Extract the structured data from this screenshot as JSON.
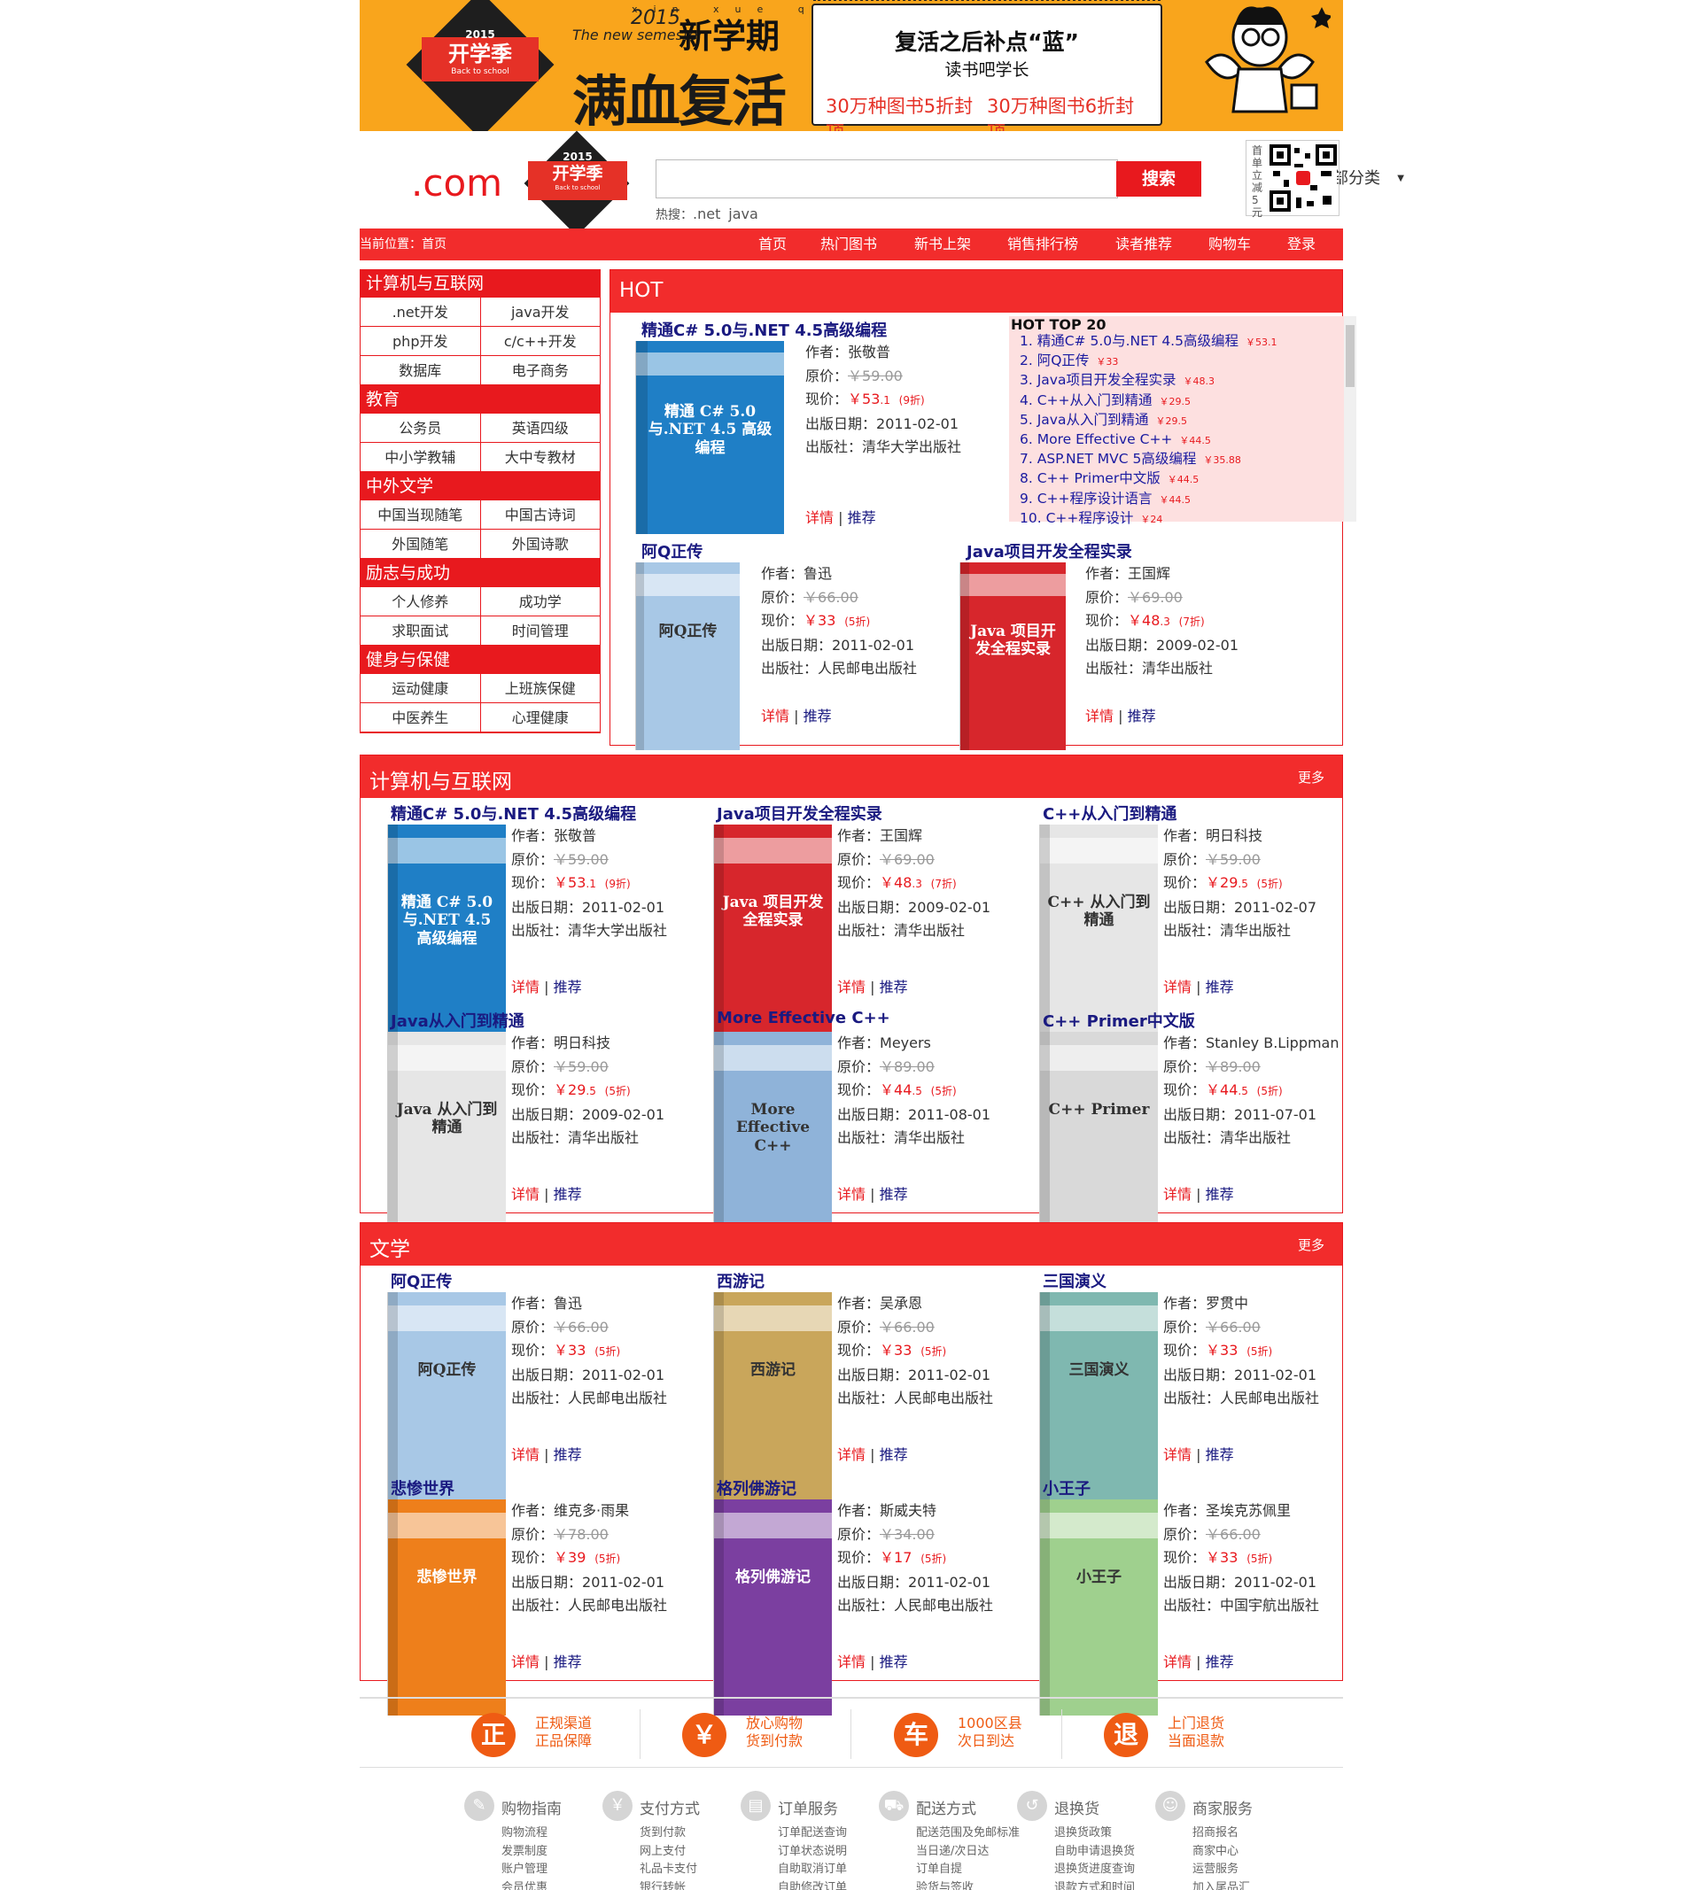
{
  "banner": {
    "badge_year": "2015",
    "badge_main": "开学季",
    "badge_sub": "Back to school",
    "pinyin": "xin xue qi",
    "year2": "2015",
    "semester_en": "The new semester",
    "semester_cn": "新学期",
    "slogan": "满血复活",
    "headline": "复活之后补点“蓝”",
    "subhead": "读书吧学长",
    "offer1": "30万种图书5折封顶",
    "offer2": "30万种图书6折封顶"
  },
  "header": {
    "logo_domain": ".com",
    "logo_badge_year": "2015",
    "logo_badge_main": "开学季",
    "logo_badge_sub": "Back to school",
    "search_placeholder": "",
    "category_select": "全部分类",
    "search_button": "搜索",
    "hot_prefix": "热搜：",
    "hot_terms": [
      ".net",
      "java"
    ],
    "qr_caption": "首单立减5元"
  },
  "nav": {
    "breadcrumb": "当前位置：首页",
    "items": [
      "首页",
      "热门图书",
      "新书上架",
      "销售排行榜",
      "读者推荐",
      "购物车",
      "登录"
    ]
  },
  "sidebar": [
    {
      "title": "计算机与互联网",
      "items": [
        ".net开发",
        "java开发",
        "php开发",
        "c/c++开发",
        "数据库",
        "电子商务"
      ]
    },
    {
      "title": "教育",
      "items": [
        "公务员",
        "英语四级",
        "中小学教辅",
        "大中专教材"
      ]
    },
    {
      "title": "中外文学",
      "items": [
        "中国当现随笔",
        "中国古诗词",
        "外国随笔",
        "外国诗歌"
      ]
    },
    {
      "title": "励志与成功",
      "items": [
        "个人修养",
        "成功学",
        "求职面试",
        "时间管理"
      ]
    },
    {
      "title": "健身与保健",
      "items": [
        "运动健康",
        "上班族保健",
        "中医养生",
        "心理健康"
      ]
    }
  ],
  "labels": {
    "author": "作者：",
    "orig_price": "原价：",
    "cur_price": "现价：",
    "pub_date": "出版日期：",
    "publisher": "出版社：",
    "detail": "详情",
    "sep": "|",
    "recommend": "推荐",
    "yen": "￥",
    "more": "更多"
  },
  "hot": {
    "title": "HOT",
    "books": [
      {
        "title": "精通C# 5.0与.NET 4.5高级编程",
        "author": "张敬普",
        "orig": "￥59.00",
        "cur_int": "￥53",
        "cur_dec": ".1",
        "discount": "(9折)",
        "date": "2011-02-01",
        "publisher": "清华大学出版社",
        "cover_color": "#1f7fc6",
        "cover_text": "精通 C# 5.0与.NET 4.5 高级编程"
      },
      {
        "title": "阿Q正传",
        "author": "鲁迅",
        "orig": "￥66.00",
        "cur_int": "￥33",
        "cur_dec": "",
        "discount": "(5折)",
        "date": "2011-02-01",
        "publisher": "人民邮电出版社",
        "cover_color": "#a8c8e6",
        "cover_text": "阿Q正传"
      },
      {
        "title": "Java项目开发全程实录",
        "author": "王国辉",
        "orig": "￥69.00",
        "cur_int": "￥48",
        "cur_dec": ".3",
        "discount": "(7折)",
        "date": "2009-02-01",
        "publisher": "清华出版社",
        "cover_color": "#d7262c",
        "cover_text": "Java 项目开发全程实录"
      }
    ],
    "top20": {
      "title": "HOT TOP 20",
      "items": [
        {
          "rank": "1.",
          "name": "精通C# 5.0与.NET 4.5高级编程",
          "price": "￥53.1"
        },
        {
          "rank": "2.",
          "name": "阿Q正传",
          "price": "￥33"
        },
        {
          "rank": "3.",
          "name": "Java项目开发全程实录",
          "price": "￥48.3"
        },
        {
          "rank": "4.",
          "name": "C++从入门到精通",
          "price": "￥29.5"
        },
        {
          "rank": "5.",
          "name": "Java从入门到精通",
          "price": "￥29.5"
        },
        {
          "rank": "6.",
          "name": "More Effective C++",
          "price": "￥44.5"
        },
        {
          "rank": "7.",
          "name": "ASP.NET MVC 5高级编程",
          "price": "￥35.88"
        },
        {
          "rank": "8.",
          "name": "C++ Primer中文版",
          "price": "￥44.5"
        },
        {
          "rank": "9.",
          "name": "C++程序设计语言",
          "price": "￥44.5"
        },
        {
          "rank": "10.",
          "name": "C++程序设计",
          "price": "￥24"
        }
      ]
    }
  },
  "sections": [
    {
      "title": "计算机与互联网",
      "books": [
        {
          "title": "精通C# 5.0与.NET 4.5高级编程",
          "author": "张敬普",
          "orig": "￥59.00",
          "cur_int": "￥53",
          "cur_dec": ".1",
          "discount": "(9折)",
          "date": "2011-02-01",
          "publisher": "清华大学出版社",
          "cover_color": "#1f7fc6",
          "cover_text": "精通 C# 5.0与.NET 4.5 高级编程"
        },
        {
          "title": "Java项目开发全程实录",
          "author": "王国辉",
          "orig": "￥69.00",
          "cur_int": "￥48",
          "cur_dec": ".3",
          "discount": "(7折)",
          "date": "2009-02-01",
          "publisher": "清华出版社",
          "cover_color": "#d7262c",
          "cover_text": "Java 项目开发全程实录"
        },
        {
          "title": "C++从入门到精通",
          "author": "明日科技",
          "orig": "￥59.00",
          "cur_int": "￥29",
          "cur_dec": ".5",
          "discount": "(5折)",
          "date": "2011-02-07",
          "publisher": "清华出版社",
          "cover_color": "#e6e6e6",
          "cover_text": "C++ 从入门到精通"
        },
        {
          "title": "Java从入门到精通",
          "author": "明日科技",
          "orig": "￥59.00",
          "cur_int": "￥29",
          "cur_dec": ".5",
          "discount": "(5折)",
          "date": "2009-02-01",
          "publisher": "清华出版社",
          "cover_color": "#e6e6e6",
          "cover_text": "Java 从入门到精通"
        },
        {
          "title": "More Effective C++",
          "author": "Meyers",
          "orig": "￥89.00",
          "cur_int": "￥44",
          "cur_dec": ".5",
          "discount": "(5折)",
          "date": "2011-08-01",
          "publisher": "清华出版社",
          "cover_color": "#8fb3d9",
          "cover_text": "More Effective C++"
        },
        {
          "title": "C++ Primer中文版",
          "author": "Stanley B.Lippman",
          "orig": "￥89.00",
          "cur_int": "￥44",
          "cur_dec": ".5",
          "discount": "(5折)",
          "date": "2011-07-01",
          "publisher": "清华出版社",
          "cover_color": "#d9d9d9",
          "cover_text": "C++ Primer"
        }
      ]
    },
    {
      "title": "文学",
      "books": [
        {
          "title": "阿Q正传",
          "author": "鲁迅",
          "orig": "￥66.00",
          "cur_int": "￥33",
          "cur_dec": "",
          "discount": "(5折)",
          "date": "2011-02-01",
          "publisher": "人民邮电出版社",
          "cover_color": "#a8c8e6",
          "cover_text": "阿Q正传"
        },
        {
          "title": "西游记",
          "author": "吴承恩",
          "orig": "￥66.00",
          "cur_int": "￥33",
          "cur_dec": "",
          "discount": "(5折)",
          "date": "2011-02-01",
          "publisher": "人民邮电出版社",
          "cover_color": "#c9a65b",
          "cover_text": "西游记"
        },
        {
          "title": "三国演义",
          "author": "罗贯中",
          "orig": "￥66.00",
          "cur_int": "￥33",
          "cur_dec": "",
          "discount": "(5折)",
          "date": "2011-02-01",
          "publisher": "人民邮电出版社",
          "cover_color": "#7fb8b0",
          "cover_text": "三国演义"
        },
        {
          "title": "悲惨世界",
          "author": "维克多·雨果",
          "orig": "￥78.00",
          "cur_int": "￥39",
          "cur_dec": "",
          "discount": "(5折)",
          "date": "2011-02-01",
          "publisher": "人民邮电出版社",
          "cover_color": "#ee7f1b",
          "cover_text": "悲惨世界"
        },
        {
          "title": "格列佛游记",
          "author": "斯威夫特",
          "orig": "￥34.00",
          "cur_int": "￥17",
          "cur_dec": "",
          "discount": "(5折)",
          "date": "2011-02-01",
          "publisher": "人民邮电出版社",
          "cover_color": "#7b3fa0",
          "cover_text": "格列佛游记"
        },
        {
          "title": "小王子",
          "author": "圣埃克苏佩里",
          "orig": "￥66.00",
          "cur_int": "￥33",
          "cur_dec": "",
          "discount": "(5折)",
          "date": "2011-02-01",
          "publisher": "中国宇航出版社",
          "cover_color": "#9fd08e",
          "cover_text": "小王子"
        }
      ]
    }
  ],
  "services": [
    {
      "icon": "正",
      "line1": "正规渠道",
      "line2": "正品保障"
    },
    {
      "icon": "￥",
      "line1": "放心购物",
      "line2": "货到付款"
    },
    {
      "icon": "车",
      "line1": "1000区县",
      "line2": "次日到达"
    },
    {
      "icon": "退",
      "line1": "上门退货",
      "line2": "当面退款"
    }
  ],
  "footer": [
    {
      "icon": "✎",
      "title": "购物指南",
      "links": [
        "购物流程",
        "发票制度",
        "账户管理",
        "会员优惠"
      ]
    },
    {
      "icon": "￥",
      "title": "支付方式",
      "links": [
        "货到付款",
        "网上支付",
        "礼品卡支付",
        "银行转帐"
      ]
    },
    {
      "icon": "▤",
      "title": "订单服务",
      "links": [
        "订单配送查询",
        "订单状态说明",
        "自助取消订单",
        "自助修改订单"
      ]
    },
    {
      "icon": "⛟",
      "title": "配送方式",
      "links": [
        "配送范围及免邮标准",
        "当日递/次日达",
        "订单自提",
        "验货与签收"
      ]
    },
    {
      "icon": "↺",
      "title": "退换货",
      "links": [
        "退换货政策",
        "自助申请退换货",
        "退换货进度查询",
        "退款方式和时间"
      ]
    },
    {
      "icon": "☺",
      "title": "商家服务",
      "links": [
        "招商报名",
        "商家中心",
        "运营服务",
        "加入尾品汇"
      ]
    }
  ]
}
